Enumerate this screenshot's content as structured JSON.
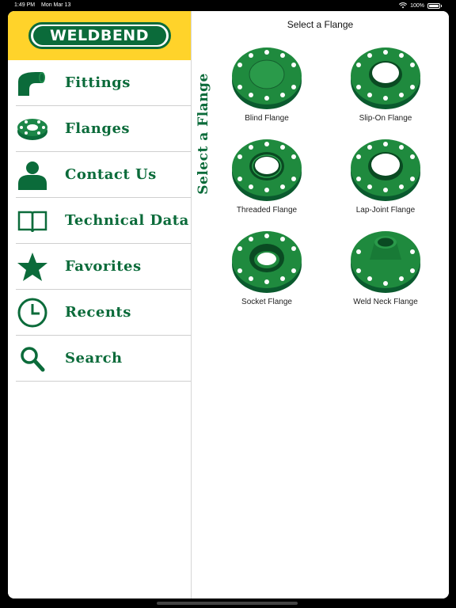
{
  "status_bar": {
    "time": "1:49 PM",
    "date": "Mon Mar 13",
    "battery": "100%"
  },
  "brand": {
    "logo_text": "WELDBEND",
    "green": "#0b6b3a",
    "yellow": "#ffd32a"
  },
  "sidebar": {
    "items": [
      {
        "label": "Fittings",
        "icon": "elbow-fitting-icon"
      },
      {
        "label": "Flanges",
        "icon": "flange-icon"
      },
      {
        "label": "Contact Us",
        "icon": "person-icon"
      },
      {
        "label": "Technical Data",
        "icon": "book-icon"
      },
      {
        "label": "Favorites",
        "icon": "star-icon"
      },
      {
        "label": "Recents",
        "icon": "clock-icon"
      },
      {
        "label": "Search",
        "icon": "search-icon"
      }
    ]
  },
  "main": {
    "title": "Select a Flange",
    "vertical_title": "Select a Flange",
    "flanges": [
      {
        "label": "Blind Flange",
        "type": "blind"
      },
      {
        "label": "Slip-On Flange",
        "type": "slipon"
      },
      {
        "label": "Threaded Flange",
        "type": "threaded"
      },
      {
        "label": "Lap-Joint Flange",
        "type": "lapjoint"
      },
      {
        "label": "Socket Flange",
        "type": "socket"
      },
      {
        "label": "Weld Neck Flange",
        "type": "weldneck"
      }
    ]
  }
}
